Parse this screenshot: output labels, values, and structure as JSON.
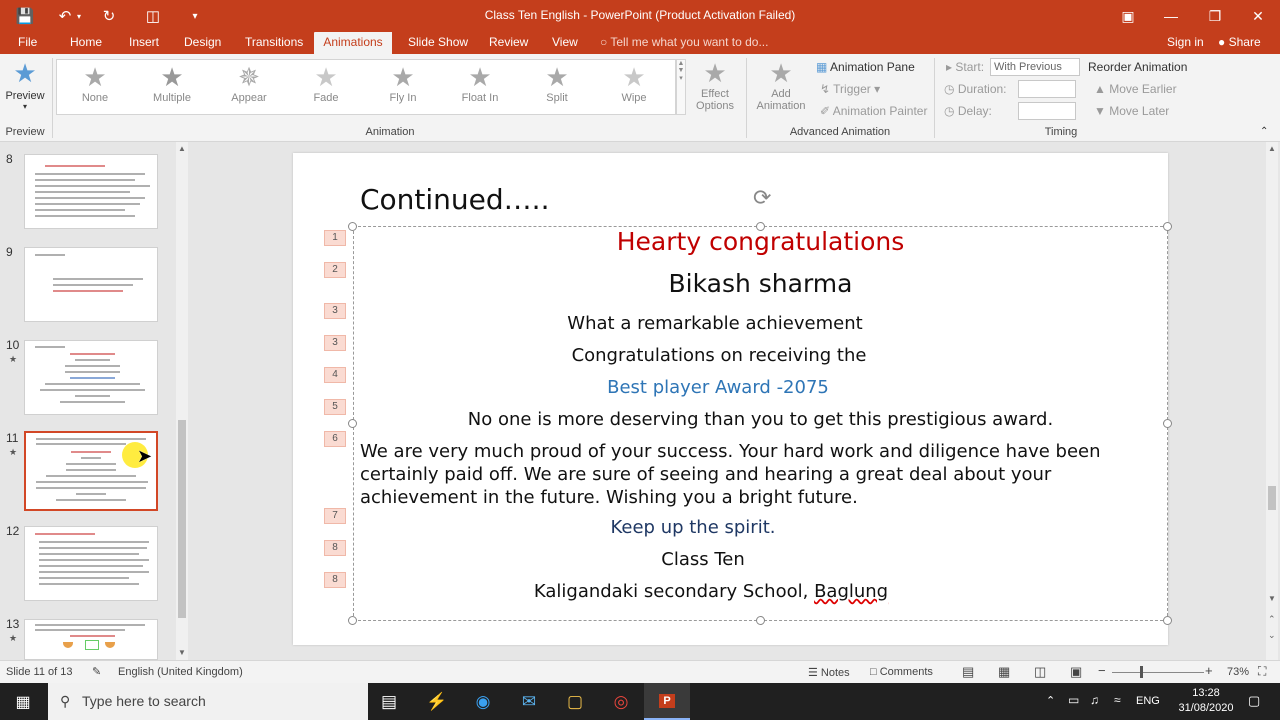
{
  "titlebar": {
    "title": "Class Ten English - PowerPoint (Product Activation Failed)"
  },
  "tabs": [
    {
      "label": "File"
    },
    {
      "label": "Home"
    },
    {
      "label": "Insert"
    },
    {
      "label": "Design"
    },
    {
      "label": "Transitions"
    },
    {
      "label": "Animations"
    },
    {
      "label": "Slide Show"
    },
    {
      "label": "Review"
    },
    {
      "label": "View"
    }
  ],
  "tell_me": "Tell me what you want to do...",
  "sign_in": "Sign in",
  "share": "Share",
  "ribbon": {
    "preview": "Preview",
    "preview_group": "Preview",
    "animations": [
      {
        "label": "None"
      },
      {
        "label": "Multiple"
      },
      {
        "label": "Appear"
      },
      {
        "label": "Fade"
      },
      {
        "label": "Fly In"
      },
      {
        "label": "Float In"
      },
      {
        "label": "Split"
      },
      {
        "label": "Wipe"
      }
    ],
    "animation_group": "Animation",
    "effect_options_1": "Effect",
    "effect_options_2": "Options",
    "add_animation_1": "Add",
    "add_animation_2": "Animation",
    "animation_pane": "Animation Pane",
    "trigger": "Trigger",
    "animation_painter": "Animation Painter",
    "advanced_group": "Advanced Animation",
    "start_label": "Start:",
    "start_value": "With Previous",
    "duration_label": "Duration:",
    "delay_label": "Delay:",
    "reorder": "Reorder Animation",
    "move_earlier": "Move Earlier",
    "move_later": "Move Later",
    "timing_group": "Timing"
  },
  "thumbnails": [
    {
      "num": "8"
    },
    {
      "num": "9"
    },
    {
      "num": "10"
    },
    {
      "num": "11"
    },
    {
      "num": "12"
    },
    {
      "num": "13"
    }
  ],
  "slide": {
    "heading": "Continued…..",
    "badges": [
      "1",
      "2",
      "3",
      "3",
      "4",
      "5",
      "6",
      "7",
      "8",
      "8"
    ],
    "line_congrats": "Hearty congratulations",
    "line_name": "Bikash sharma",
    "line_achievement": "What a remarkable achievement",
    "line_receiving": "Congratulations on receiving the",
    "line_award": "Best player Award -2075",
    "line_deserving": "No one is more deserving than you to get this prestigious award.",
    "para_1": "We are very much proud of your success. Your hard work and diligence have been",
    "para_2": "certainly paid off. We are sure of seeing and hearing a great deal about your",
    "para_3": "achievement in the future. Wishing you a bright future.",
    "line_spirit": "Keep up the spirit.",
    "line_class": "Class Ten",
    "line_school_a": "Kaligandaki secondary School, ",
    "line_school_b": "Baglung"
  },
  "status": {
    "slide_info": "Slide 11 of 13",
    "language": "English (United Kingdom)",
    "notes": "Notes",
    "comments": "Comments",
    "zoom": "73%"
  },
  "taskbar": {
    "search": "Type here to search",
    "lang": "ENG",
    "time": "13:28",
    "date": "31/08/2020"
  },
  "colors": {
    "accent": "#c43e1c",
    "red_text": "#c00000",
    "blue_text": "#2e75b6",
    "navy_text": "#1f3864"
  }
}
